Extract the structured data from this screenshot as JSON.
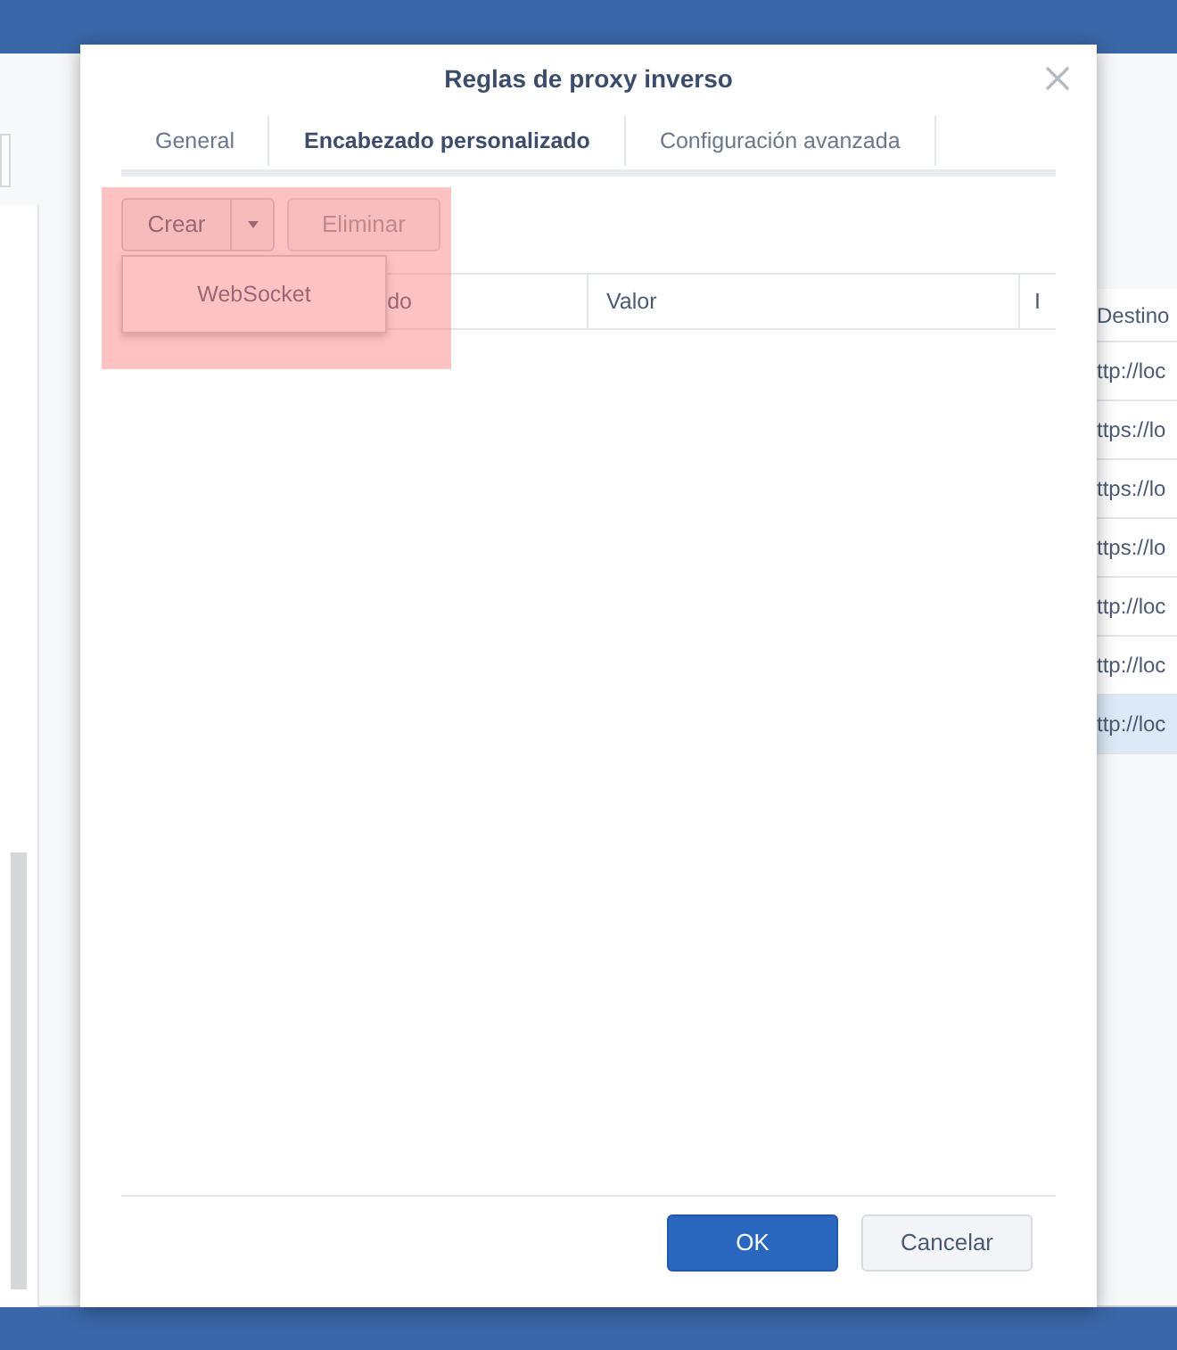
{
  "background_window": {
    "table": {
      "column": "Destino",
      "rows": [
        {
          "text": "ttp://loc",
          "selected": false
        },
        {
          "text": "ttps://lo",
          "selected": false
        },
        {
          "text": "ttps://lo",
          "selected": false
        },
        {
          "text": "ttps://lo",
          "selected": false
        },
        {
          "text": "ttp://loc",
          "selected": false
        },
        {
          "text": "ttp://loc",
          "selected": false
        },
        {
          "text": "ttp://loc",
          "selected": true
        }
      ]
    }
  },
  "dialog": {
    "title": "Reglas de proxy inverso",
    "tabs": [
      {
        "label": "General",
        "selected": false
      },
      {
        "label": "Encabezado personalizado",
        "selected": true
      },
      {
        "label": "Configuración avanzada",
        "selected": false
      }
    ],
    "toolbar": {
      "create": "Crear",
      "delete": {
        "label": "Eliminar",
        "disabled": true
      }
    },
    "menu": {
      "items": [
        "WebSocket"
      ]
    },
    "table": {
      "columns": [
        "do",
        "Valor",
        "I"
      ]
    },
    "buttons": [
      {
        "label": "OK",
        "kind": "primary"
      },
      {
        "label": "Cancelar",
        "kind": "secondary"
      }
    ]
  }
}
